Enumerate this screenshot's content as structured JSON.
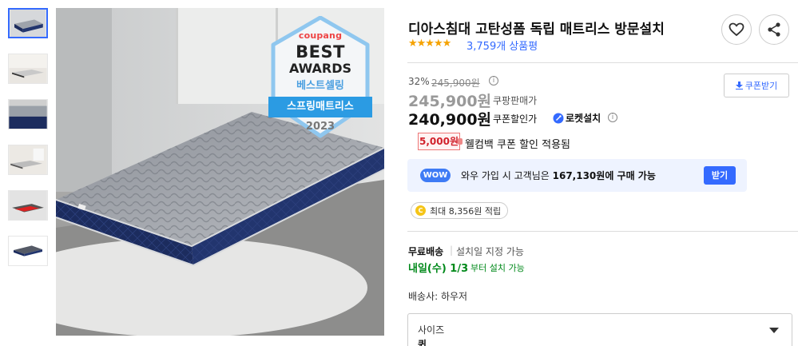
{
  "badge": {
    "brand": "coupang",
    "line1": "BEST",
    "line2": "AWARDS",
    "line3": "베스트셀링",
    "ribbon": "스프링매트리스",
    "year": "2023"
  },
  "product": {
    "title": "디아스침대 고탄성폼 독립 매트리스 방문설치",
    "stars": "★★★★★",
    "rating": 5,
    "review_count": "3,759개 상품평"
  },
  "pricing": {
    "discount_rate": "32%",
    "original_price": "245,900원",
    "sale_price": "245,900원",
    "sale_price_label": "쿠팡판매가",
    "coupon_price": "240,900원",
    "coupon_price_label": "쿠폰할인가",
    "rocket_label": "로켓설치",
    "coupon_button": "쿠폰받기",
    "coupon_amount": "5,000원",
    "coupon_text": "웰컴백 쿠폰 할인 적용됨"
  },
  "wow": {
    "badge": "WOW",
    "text_prefix": "와우 가입 시 고객님은 ",
    "text_amount": "167,130원에 구매 가능",
    "button": "받기"
  },
  "points": {
    "coin": "C",
    "text": "최대 8,356원 적립"
  },
  "shipping": {
    "free": "무료배송",
    "separator": "|",
    "schedule": "설치일 지정 가능",
    "date": "내일(수) 1/3",
    "date_note": "부터 설치 가능",
    "seller": "배송사: 하우저"
  },
  "option": {
    "label": "사이즈",
    "value": "퀸"
  },
  "colors": {
    "accent_blue": "#346aff",
    "star": "#f5a200",
    "delivery_green": "#00891a",
    "coupon_red": "#d1222c",
    "mattress_navy": "#1c2c5e"
  }
}
